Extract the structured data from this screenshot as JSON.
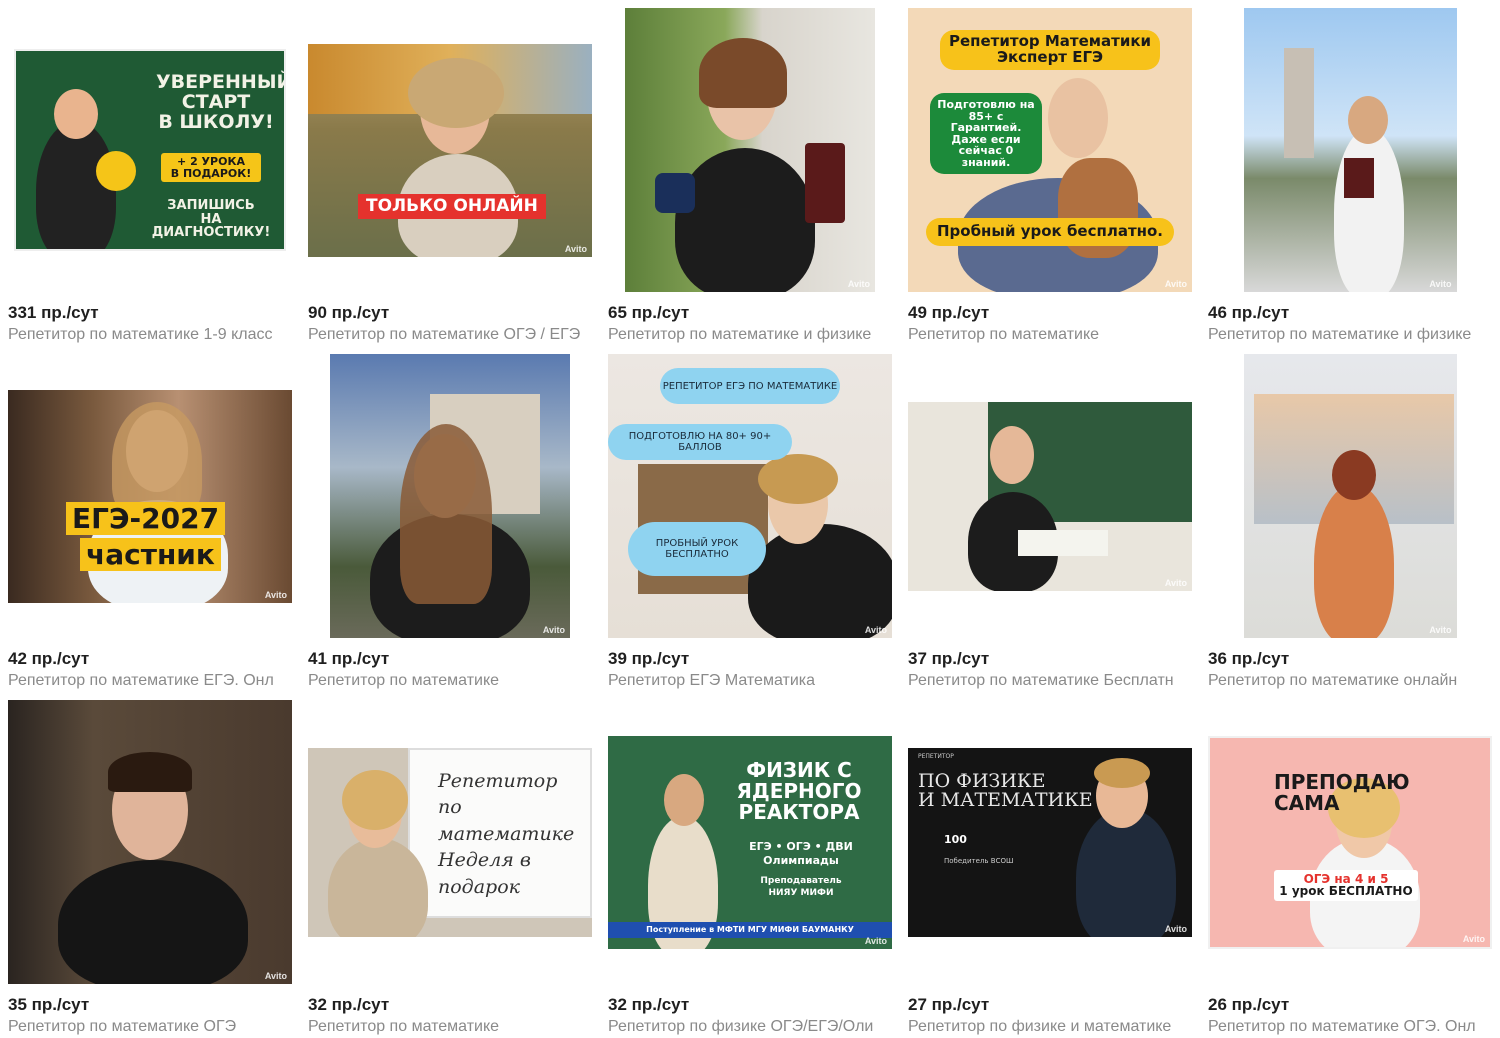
{
  "listings": [
    {
      "views": "331 пр./сут",
      "title": "Репетитор по математике 1-9 класс",
      "overlay": [
        "УВЕРЕННЫЙ",
        "СТАРТ",
        "В ШКОЛУ!",
        "+ 2 УРОКА",
        "В ПОДАРОК!",
        "ЗАПИШИСЬ",
        "НА ДИАГНОСТИКУ!"
      ]
    },
    {
      "views": "90 пр./сут",
      "title": "Репетитор по математике ОГЭ / ЕГЭ",
      "overlay": [
        "ТОЛЬКО ОНЛАЙН"
      ],
      "watermark": "Avito"
    },
    {
      "views": "65 пр./сут",
      "title": "Репетитор по математике и физике",
      "watermark": "Avito"
    },
    {
      "views": "49 пр./сут",
      "title": "Репетитор по математике",
      "overlay": [
        "Репетитор Математики",
        "Эксперт ЕГЭ",
        "Подготовлю на",
        "85+ с Гарантией.",
        "Даже если",
        "сейчас 0 знаний.",
        "Пробный урок бесплатно."
      ],
      "watermark": "Avito"
    },
    {
      "views": "46 пр./сут",
      "title": "Репетитор по математике и физике",
      "watermark": "Avito"
    },
    {
      "views": "42 пр./сут",
      "title": "Репетитор по математике ЕГЭ. Онл",
      "overlay": [
        "ЕГЭ-2027",
        "частник"
      ],
      "watermark": "Avito"
    },
    {
      "views": "41 пр./сут",
      "title": "Репетитор по математике",
      "watermark": "Avito"
    },
    {
      "views": "39 пр./сут",
      "title": "Репетитор ЕГЭ Математика",
      "overlay": [
        "РЕПЕТИТОР ЕГЭ ПО МАТЕМАТИКЕ",
        "ПОДГОТОВЛЮ НА 80+ 90+ БАЛЛОВ",
        "ПРОБНЫЙ УРОК",
        "БЕСПЛАТНО"
      ],
      "watermark": "Avito"
    },
    {
      "views": "37 пр./сут",
      "title": "Репетитор по математике Бесплатн",
      "watermark": "Avito"
    },
    {
      "views": "36 пр./сут",
      "title": "Репетитор по математике онлайн",
      "watermark": "Avito"
    },
    {
      "views": "35 пр./сут",
      "title": "Репетитор по математике ОГЭ",
      "watermark": "Avito"
    },
    {
      "views": "32 пр./сут",
      "title": "Репетитор по математике",
      "overlay": [
        "Репетитор",
        "по математике",
        "Неделя в подарок"
      ]
    },
    {
      "views": "32 пр./сут",
      "title": "Репетитор по физике ОГЭ/ЕГЭ/Оли",
      "overlay": [
        "ФИЗИК С",
        "ЯДЕРНОГО",
        "РЕАКТОРА",
        "ЕГЭ • ОГЭ • ДВИ",
        "Олимпиады",
        "Преподаватель",
        "НИЯУ МИФИ",
        "Поступление в МФТИ МГУ МИФИ БАУМАНКУ"
      ],
      "watermark": "Avito"
    },
    {
      "views": "27 пр./сут",
      "title": "Репетитор по физике и математике",
      "overlay": [
        "РЕПЕТИТОР",
        "ПО ФИЗИКЕ",
        "И МАТЕМАТИКЕ",
        "100",
        "Победитель ВСОШ"
      ],
      "watermark": "Avito"
    },
    {
      "views": "26 пр./сут",
      "title": "Репетитор по математике ОГЭ. Онл",
      "overlay": [
        "ПРЕПОДАЮ",
        "САМА",
        "ОГЭ на 4 и 5",
        "1 урок БЕСПЛАТНО"
      ],
      "watermark": "Avito"
    }
  ],
  "colors": {
    "views": "#1f1f1f",
    "title": "#8a8a8a",
    "accent_yellow": "#f7c21a",
    "accent_red": "#e5322d",
    "board_green": "#2f6b45"
  }
}
